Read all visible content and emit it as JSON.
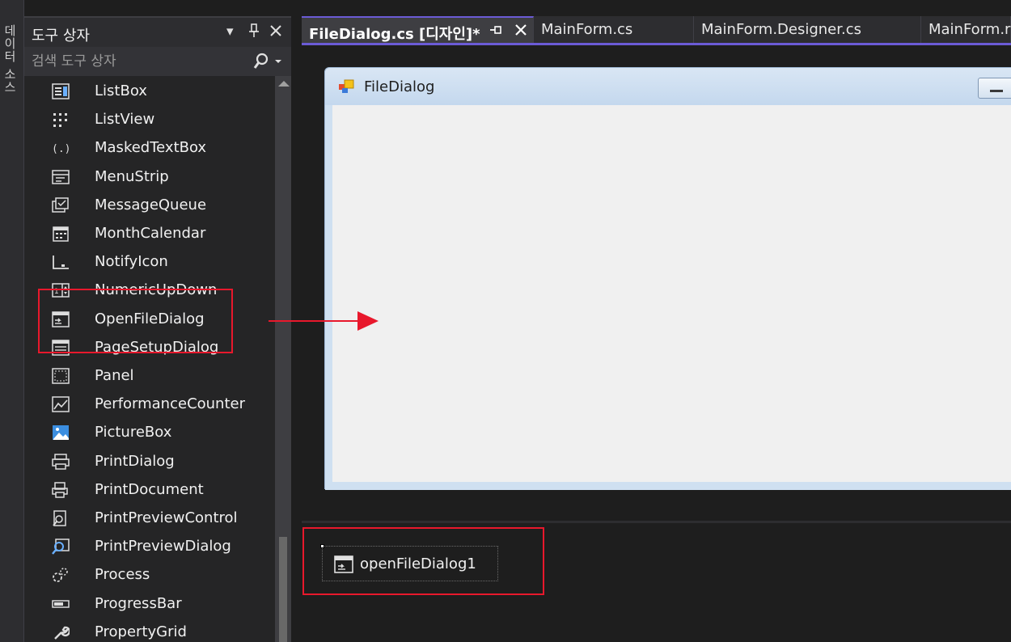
{
  "side_strip": {
    "label": "데이터 소스"
  },
  "toolbox": {
    "title": "도구 상자",
    "search_placeholder": "검색 도구 상자",
    "items": [
      {
        "label": "ListBox",
        "icon": "listbox-icon"
      },
      {
        "label": "ListView",
        "icon": "listview-icon"
      },
      {
        "label": "MaskedTextBox",
        "icon": "maskedtextbox-icon"
      },
      {
        "label": "MenuStrip",
        "icon": "menustrip-icon"
      },
      {
        "label": "MessageQueue",
        "icon": "messagequeue-icon"
      },
      {
        "label": "MonthCalendar",
        "icon": "monthcalendar-icon"
      },
      {
        "label": "NotifyIcon",
        "icon": "notifyicon-icon"
      },
      {
        "label": "NumericUpDown",
        "icon": "numericupdown-icon"
      },
      {
        "label": "OpenFileDialog",
        "icon": "openfiledialog-icon"
      },
      {
        "label": "PageSetupDialog",
        "icon": "pagesetupdialog-icon"
      },
      {
        "label": "Panel",
        "icon": "panel-icon"
      },
      {
        "label": "PerformanceCounter",
        "icon": "performancecounter-icon"
      },
      {
        "label": "PictureBox",
        "icon": "picturebox-icon"
      },
      {
        "label": "PrintDialog",
        "icon": "printdialog-icon"
      },
      {
        "label": "PrintDocument",
        "icon": "printdocument-icon"
      },
      {
        "label": "PrintPreviewControl",
        "icon": "printpreviewcontrol-icon"
      },
      {
        "label": "PrintPreviewDialog",
        "icon": "printpreviewdialog-icon"
      },
      {
        "label": "Process",
        "icon": "process-icon"
      },
      {
        "label": "ProgressBar",
        "icon": "progressbar-icon"
      },
      {
        "label": "PropertyGrid",
        "icon": "propertygrid-icon"
      }
    ]
  },
  "tabs": [
    {
      "label": "FileDialog.cs [디자인]*",
      "active": true
    },
    {
      "label": "MainForm.cs",
      "active": false
    },
    {
      "label": "MainForm.Designer.cs",
      "active": false
    },
    {
      "label": "MainForm.r",
      "active": false
    }
  ],
  "form": {
    "title": "FileDialog"
  },
  "tray": {
    "component_label": "openFileDialog1"
  },
  "colors": {
    "accent": "#6b5bd6",
    "annotation_red": "#e8182c",
    "background": "#1e1e1e",
    "panel": "#252526"
  }
}
